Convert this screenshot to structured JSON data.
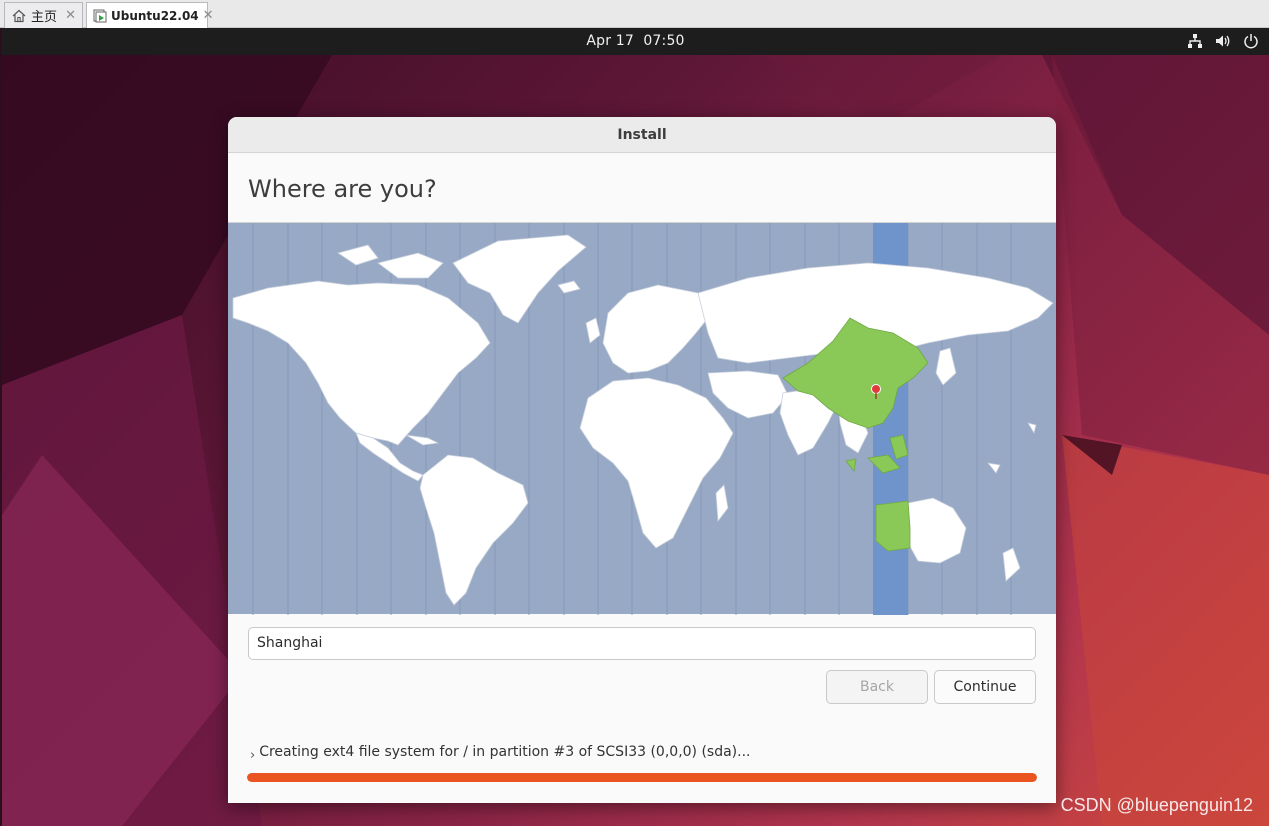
{
  "vm_tabs": [
    {
      "label": "主页",
      "icon": "home-icon",
      "active": false
    },
    {
      "label": "Ubuntu22.04",
      "icon": "vm-icon",
      "active": true
    }
  ],
  "topbar": {
    "clock": "Apr 17  07:50",
    "tray_icons": [
      "network-icon",
      "volume-icon",
      "power-icon"
    ]
  },
  "window": {
    "title": "Install",
    "heading": "Where are you?",
    "timezone_value": "Shanghai",
    "back_label": "Back",
    "back_enabled": false,
    "continue_label": "Continue",
    "status_text": "Creating ext4 file system for / in partition #3 of SCSI33 (0,0,0) (sda)...",
    "progress_fraction": 1.0
  },
  "map": {
    "ocean_color": "#97a9c5",
    "land_color": "#ffffff",
    "selected_color": "#8ac858",
    "timezone_band_color": "#6f94cc",
    "pin_color": "#e03a3a"
  },
  "colors": {
    "accent": "#e95420"
  },
  "watermark": "CSDN @bluepenguin12"
}
